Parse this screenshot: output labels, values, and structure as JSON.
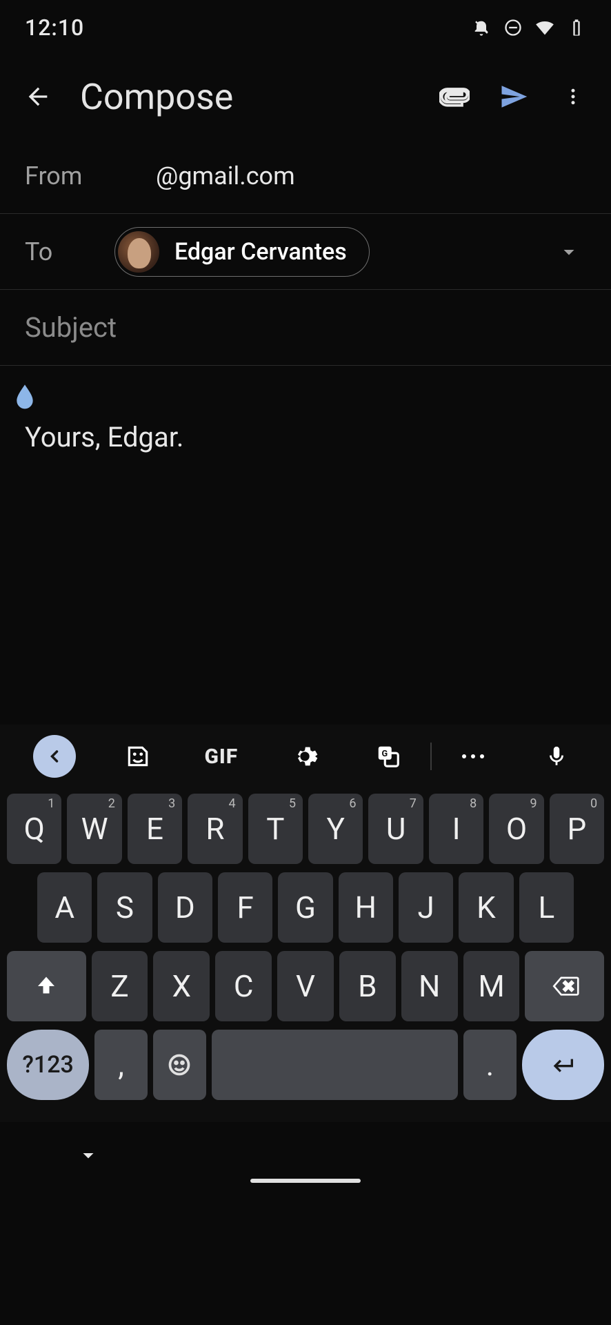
{
  "status": {
    "time": "12:10"
  },
  "header": {
    "title": "Compose"
  },
  "fields": {
    "from_label": "From",
    "from_value": "@gmail.com",
    "to_label": "To",
    "to_contact": "Edgar Cervantes",
    "subject_placeholder": "Subject"
  },
  "body": {
    "text": "Yours, Edgar."
  },
  "keyboard": {
    "toolbar": {
      "gif": "GIF"
    },
    "row1": [
      {
        "k": "Q",
        "s": "1"
      },
      {
        "k": "W",
        "s": "2"
      },
      {
        "k": "E",
        "s": "3"
      },
      {
        "k": "R",
        "s": "4"
      },
      {
        "k": "T",
        "s": "5"
      },
      {
        "k": "Y",
        "s": "6"
      },
      {
        "k": "U",
        "s": "7"
      },
      {
        "k": "I",
        "s": "8"
      },
      {
        "k": "O",
        "s": "9"
      },
      {
        "k": "P",
        "s": "0"
      }
    ],
    "row2": [
      "A",
      "S",
      "D",
      "F",
      "G",
      "H",
      "J",
      "K",
      "L"
    ],
    "row3": [
      "Z",
      "X",
      "C",
      "V",
      "B",
      "N",
      "M"
    ],
    "sym": "?123",
    "comma": ",",
    "period": "."
  }
}
